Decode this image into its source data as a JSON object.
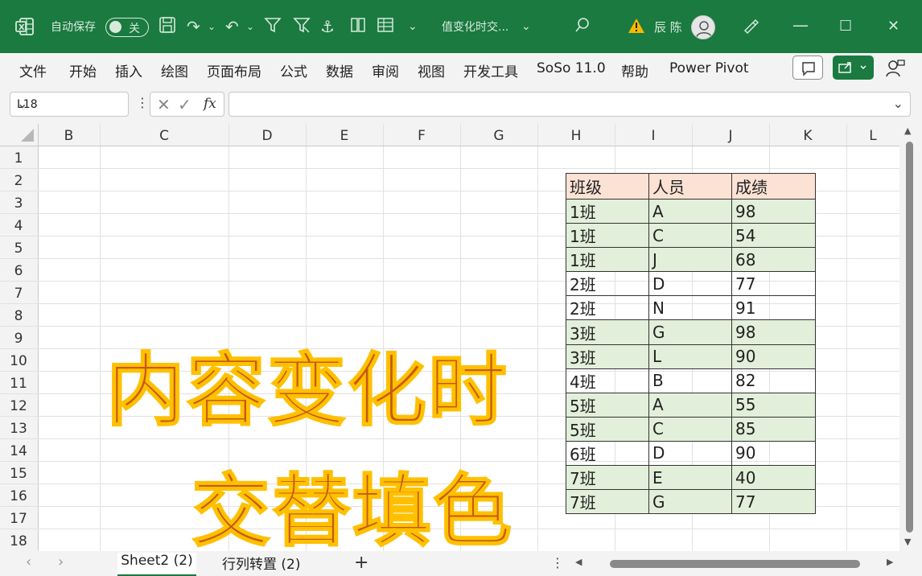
{
  "titlebar": {
    "autosave_label": "自动保存",
    "autosave_state": "关",
    "doc_title": "值变化时交...",
    "user_name": "辰 陈",
    "bg_color": "#1a7a40"
  },
  "menu": [
    "文件",
    "开始",
    "插入",
    "绘图",
    "页面布局",
    "公式",
    "数据",
    "审阅",
    "视图",
    "开发工具",
    "SoSo 11.0",
    "帮助",
    "Power Pivot"
  ],
  "formula_bar": {
    "name_box": "L18",
    "fx_label": "fx",
    "formula_value": ""
  },
  "columns": [
    "B",
    "C",
    "D",
    "E",
    "F",
    "G",
    "H",
    "I",
    "J",
    "K",
    "L"
  ],
  "rows": [
    "1",
    "2",
    "3",
    "4",
    "5",
    "6",
    "7",
    "8",
    "9",
    "10",
    "11",
    "12",
    "13",
    "14",
    "15",
    "16",
    "17",
    "18"
  ],
  "headline": {
    "line1": "内容变化时",
    "line2": "交替填色",
    "fill_color": "#c55a11",
    "outline_color": "#ffc000"
  },
  "table": {
    "headers": [
      "班级",
      "人员",
      "成绩"
    ],
    "header_color": "#fbe2d5",
    "band_color": "#e2efda",
    "rows": [
      {
        "cls": "1班",
        "person": "A",
        "score": "98",
        "banded": true
      },
      {
        "cls": "1班",
        "person": "C",
        "score": "54",
        "banded": true
      },
      {
        "cls": "1班",
        "person": "J",
        "score": "68",
        "banded": true
      },
      {
        "cls": "2班",
        "person": "D",
        "score": "77",
        "banded": false
      },
      {
        "cls": "2班",
        "person": "N",
        "score": "91",
        "banded": false
      },
      {
        "cls": "3班",
        "person": "G",
        "score": "98",
        "banded": true
      },
      {
        "cls": "3班",
        "person": "L",
        "score": "90",
        "banded": true
      },
      {
        "cls": "4班",
        "person": "B",
        "score": "82",
        "banded": false
      },
      {
        "cls": "5班",
        "person": "A",
        "score": "55",
        "banded": true
      },
      {
        "cls": "5班",
        "person": "C",
        "score": "85",
        "banded": true
      },
      {
        "cls": "6班",
        "person": "D",
        "score": "90",
        "banded": false
      },
      {
        "cls": "7班",
        "person": "E",
        "score": "40",
        "banded": true
      },
      {
        "cls": "7班",
        "person": "G",
        "score": "77",
        "banded": true
      }
    ]
  },
  "sheets": {
    "active": "Sheet2 (2)",
    "other": "行列转置 (2)",
    "add_label": "+"
  }
}
